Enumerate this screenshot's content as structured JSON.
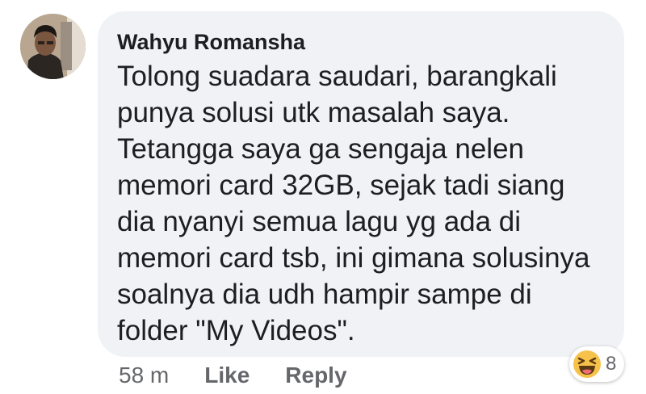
{
  "comment": {
    "author": "Wahyu Romansha",
    "text_lines": [
      "Tolong suadara saudari, barangkali",
      "punya solusi utk masalah saya.",
      "Tetangga saya ga sengaja nelen",
      "memori card 32GB, sejak tadi siang",
      "dia nyanyi semua lagu yg ada di",
      "memori card tsb, ini gimana solusinya",
      "soalnya dia udh hampir sampe di",
      "folder \"My Videos\"."
    ],
    "timestamp": "58 m",
    "like_label": "Like",
    "reply_label": "Reply",
    "reaction": {
      "icon": "haha-emoji-icon",
      "count": "8"
    }
  },
  "colors": {
    "bubble_background": "#f0f2f5",
    "text": "#1c1e21",
    "secondary_text": "#65676b",
    "emoji_yellow": "#f7c24a"
  }
}
